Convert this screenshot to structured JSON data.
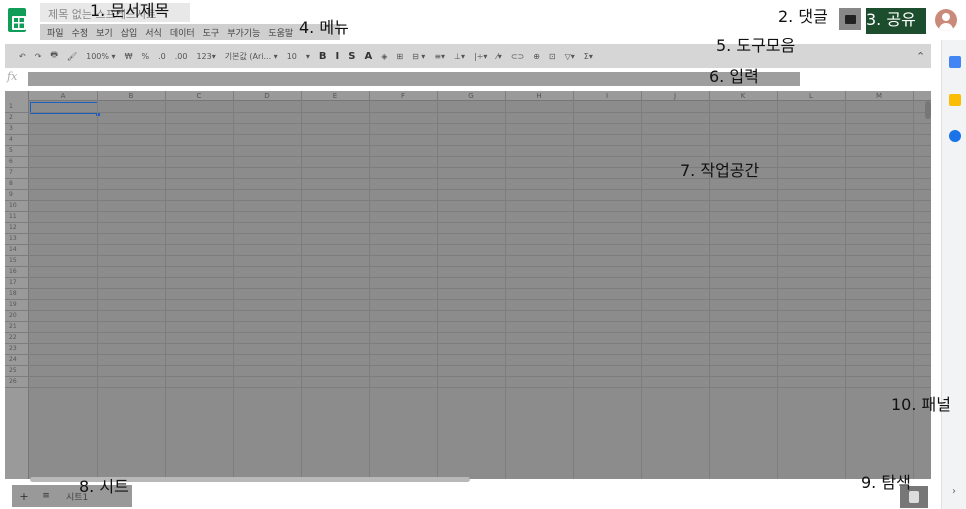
{
  "header": {
    "logo_icon": "sheets-logo-icon",
    "doc_title": "제목 없는 스프레드시트",
    "menu": [
      "파일",
      "수정",
      "보기",
      "삽입",
      "서식",
      "데이터",
      "도구",
      "부가기능",
      "도움말"
    ],
    "share_label": "공유"
  },
  "toolbar": {
    "items": [
      "↶",
      "↷",
      "🖶",
      "🖌",
      "100% ▾",
      "₩",
      "%",
      ".0",
      ".00",
      "123▾",
      "기본값 (Ari... ▾",
      "10",
      "▾",
      "B",
      "I",
      "S",
      "A",
      "◈",
      "⊞",
      "⊟ ▾",
      "≡▾",
      "⊥▾",
      "|÷▾",
      "⁄▾",
      "⊂⊃",
      "⊕",
      "⊡",
      "▽▾",
      "Σ▾"
    ],
    "collapse_icon": "chevron-up-icon"
  },
  "formula_bar": {
    "fx_label": "fx",
    "value": ""
  },
  "grid": {
    "columns": [
      "A",
      "B",
      "C",
      "D",
      "E",
      "F",
      "G",
      "H",
      "I",
      "J",
      "K",
      "L",
      "M"
    ],
    "rows": [
      "1",
      "2",
      "3",
      "4",
      "5",
      "6",
      "7",
      "8",
      "9",
      "10",
      "11",
      "12",
      "13",
      "14",
      "15",
      "16",
      "17",
      "18",
      "19",
      "20",
      "21",
      "22",
      "23",
      "24",
      "25",
      "26"
    ]
  },
  "sheets": {
    "add_icon": "+",
    "list_icon": "≡",
    "tabs": [
      "시트1"
    ]
  },
  "annotations": {
    "doc_title": "1. 문서제목",
    "comments": "2. 댓글",
    "share": "3. 공유",
    "menu": "4. 메뉴",
    "toolbar": "5. 도구모음",
    "input": "6. 입력",
    "workspace": "7. 작업공간",
    "sheet": "8. 시트",
    "explore": "9. 탐색",
    "panel": "10. 패널"
  },
  "colors": {
    "sheets_green": "#0f9d58",
    "share_dark": "#1c4e2e",
    "selection_blue": "#1a5fc1"
  }
}
